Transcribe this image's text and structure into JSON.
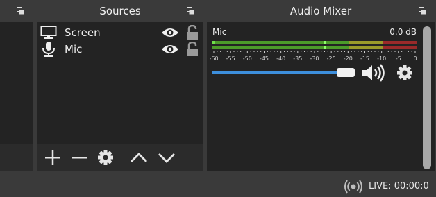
{
  "sources": {
    "title": "Sources",
    "items": [
      {
        "label": "Screen",
        "icon": "monitor-icon"
      },
      {
        "label": "Mic",
        "icon": "microphone-icon"
      }
    ],
    "toolbar": [
      "add-icon",
      "remove-icon",
      "gear-icon",
      "chevron-up-icon",
      "chevron-down-icon"
    ]
  },
  "mixer": {
    "title": "Audio Mixer",
    "channel": {
      "name": "Mic",
      "db": "0.0 dB",
      "scale": [
        "-60",
        "-55",
        "-50",
        "-45",
        "-40",
        "-35",
        "-30",
        "-25",
        "-20",
        "-15",
        "-10",
        "-5",
        "0"
      ],
      "volume": 1.0
    }
  },
  "status": {
    "live": "LIVE: 00:00:0"
  },
  "colors": {
    "panel": "#232323",
    "chrome": "#3a3a3a",
    "accent": "#3d8fdc",
    "meter_green": "#4c9a2a",
    "meter_yellow": "#9a9a2a",
    "meter_red": "#9a2a2a"
  }
}
